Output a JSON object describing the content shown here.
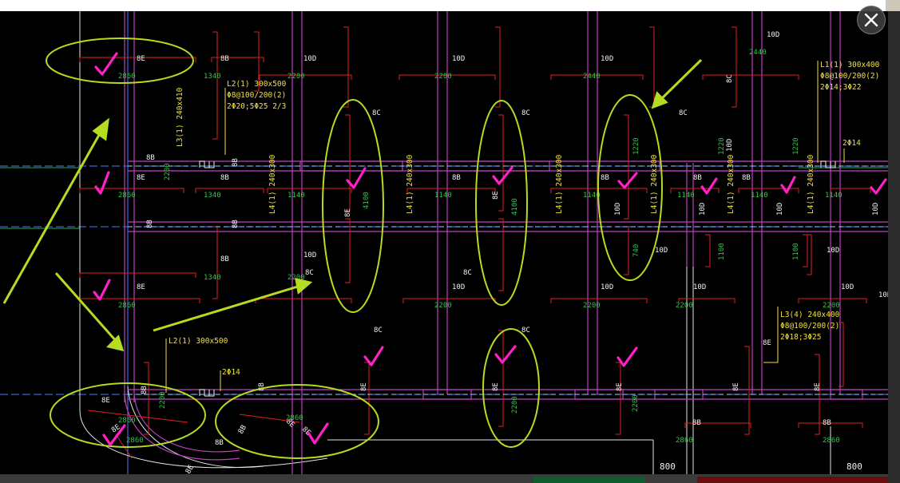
{
  "window": {
    "close_label": "close-viewer"
  },
  "colors": {
    "background": "#000000",
    "beam_outline": "#c040c0",
    "axis_line": "#4a7dff",
    "rebar_red": "#e02020",
    "text_white": "#f2f2f2",
    "text_green": "#33c24a",
    "text_yellow": "#f0e040",
    "markup_green": "#b5dc20",
    "check_magenta": "#ff20c8"
  },
  "drawing": {
    "labels_8B": [
      "8B",
      "8B",
      "8B",
      "8B",
      "8B",
      "8B",
      "8B",
      "8B",
      "8B",
      "8B",
      "8B",
      "8B",
      "8B",
      "8B",
      "8B",
      "8B",
      "8B"
    ],
    "labels_8E": [
      "8E",
      "8E",
      "8E",
      "8E",
      "8E",
      "8E",
      "8E",
      "8E",
      "8E",
      "8E",
      "8E",
      "8E",
      "8E",
      "8E",
      "8E",
      "8E"
    ],
    "labels_8C": [
      "8C",
      "8C",
      "8C",
      "8C",
      "8C",
      "8C",
      "8C",
      "8C"
    ],
    "labels_10D": [
      "10D",
      "10D",
      "10D",
      "10D",
      "10D",
      "10D",
      "10D",
      "10D",
      "10D",
      "10D",
      "10D",
      "10D",
      "10D",
      "10D",
      "10D",
      "10D",
      "10D"
    ],
    "green_dims": [
      "2860",
      "1340",
      "2200",
      "2200",
      "2440",
      "2860",
      "1340",
      "1140",
      "1140",
      "1140",
      "1140",
      "1140",
      "1140",
      "1340",
      "2200",
      "2200",
      "2200",
      "2200",
      "2200",
      "2860",
      "2860",
      "2860",
      "2860",
      "2860",
      "2860",
      "1220",
      "1220",
      "1220",
      "1100",
      "1100",
      "2200",
      "4100",
      "4100",
      "740",
      "2200",
      "2440",
      "2200",
      "2200"
    ],
    "beam_L2_1a": "L2(1) 300x500",
    "beam_L2_1a_stirrup": "Φ8@100/200(2)",
    "beam_L2_1a_rebar": "2Φ20;5Φ25 2/3",
    "beam_L1_1": "L1(1) 300x400",
    "beam_L1_1_stirrup": "Φ8@100/200(2)",
    "beam_L1_1_rebar": "2Φ14;3Φ22",
    "beam_L3_1": "L3(1) 240x410",
    "beam_L4_1": "L4(1) 240x300",
    "beam_L2_1b": "L2(1) 300x500",
    "rebar_2phi14": "2Φ14",
    "beam_L3_4": "L3(4) 240x400",
    "beam_L3_4_stirrup": "Φ8@100/200(2)",
    "beam_L3_4_rebar": "2Φ18;3Φ25",
    "dim_800": "800"
  }
}
